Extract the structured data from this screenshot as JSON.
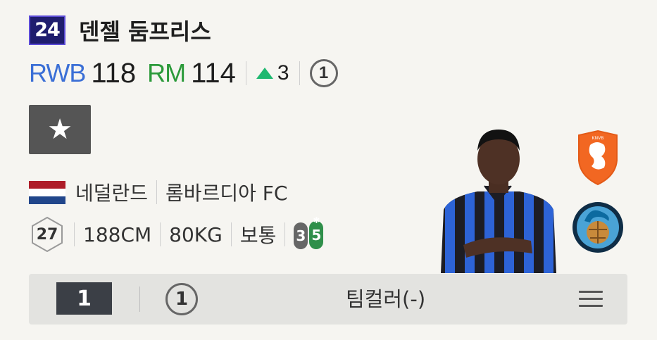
{
  "card": {
    "season": "24",
    "name": "덴젤 둠프리스",
    "positions": [
      {
        "pos": "RWB",
        "ovr": "118",
        "color": "#3b6fd6"
      },
      {
        "pos": "RM",
        "ovr": "114",
        "color": "#2b9a3a"
      }
    ],
    "upgrade": "3",
    "grade": "1",
    "nation": "네덜란드",
    "club": "롬바르디아 FC",
    "age": "27",
    "height": "188CM",
    "weight": "80KG",
    "body_type": "보통",
    "weak_foot": "3",
    "strong_foot": "5"
  },
  "bottom_bar": {
    "level": "1",
    "grade": "1",
    "team_color": "팀컬러(-)"
  },
  "colors": {
    "rwb": "#3b6fd6",
    "rm": "#2b9a3a",
    "up_arrow": "#1fb870",
    "season_badge": "#1f1d6e"
  },
  "icons": [
    "star-icon",
    "up-arrow-icon",
    "netherlands-flag-icon",
    "netherlands-crest-icon",
    "club-crest-icon",
    "menu-icon",
    "foot-icon"
  ]
}
